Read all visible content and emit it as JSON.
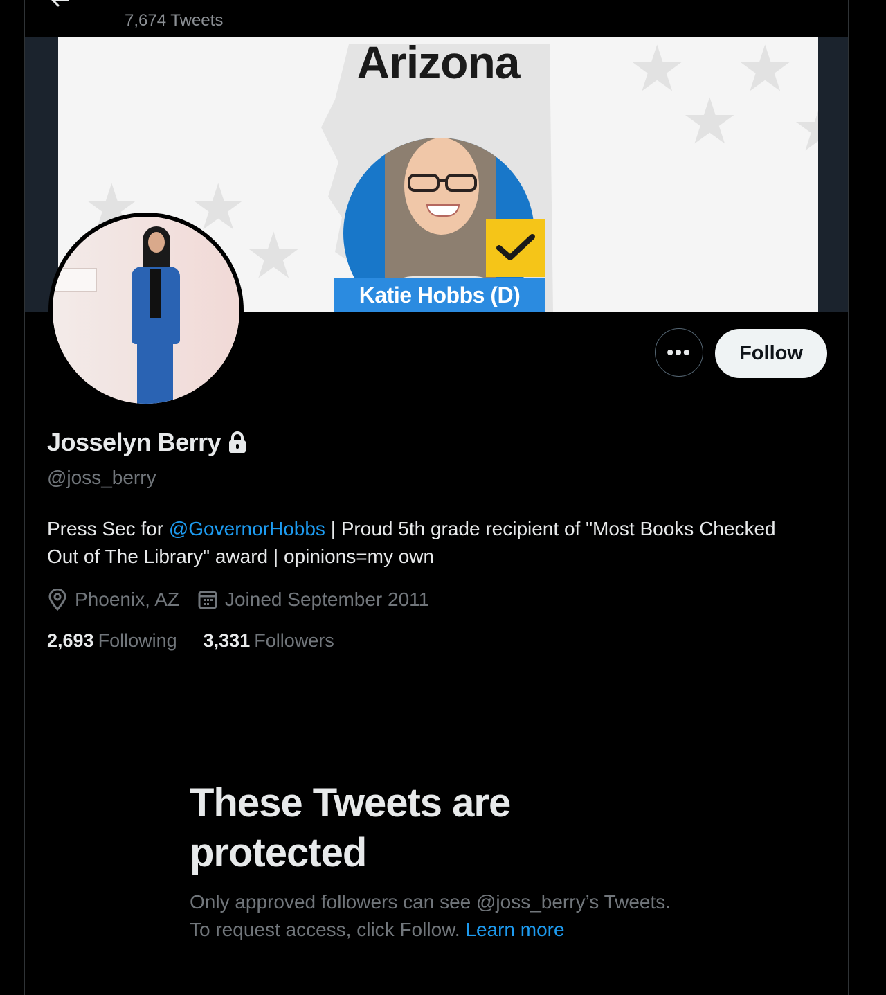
{
  "header": {
    "tweet_count": "7,674 Tweets"
  },
  "banner": {
    "heading": "Arizona",
    "name_tag": "Katie Hobbs (D)"
  },
  "profile": {
    "display_name": "Josselyn Berry",
    "handle": "@joss_berry",
    "bio_prefix": "Press Sec for ",
    "bio_mention": "@GovernorHobbs",
    "bio_suffix": " | Proud 5th grade recipient of \"Most Books Checked Out of The Library\" award | opinions=my own",
    "location": "Phoenix, AZ",
    "joined": "Joined September 2011",
    "following_count": "2,693",
    "following_label": "Following",
    "followers_count": "3,331",
    "followers_label": "Followers"
  },
  "actions": {
    "more_label": "•••",
    "follow_label": "Follow"
  },
  "protected": {
    "title": "These Tweets are protected",
    "text": "Only approved followers can see @joss_berry’s Tweets. To request access, click Follow. ",
    "link": "Learn more"
  },
  "colors": {
    "background": "#000000",
    "accent": "#1d9bf0",
    "muted_text": "#71767b",
    "banner_tag": "#2b8be0",
    "check_badge": "#f5c518"
  },
  "icons": [
    "back-arrow-icon",
    "lock-icon",
    "location-pin-icon",
    "calendar-icon",
    "more-icon",
    "checkmark-icon"
  ]
}
